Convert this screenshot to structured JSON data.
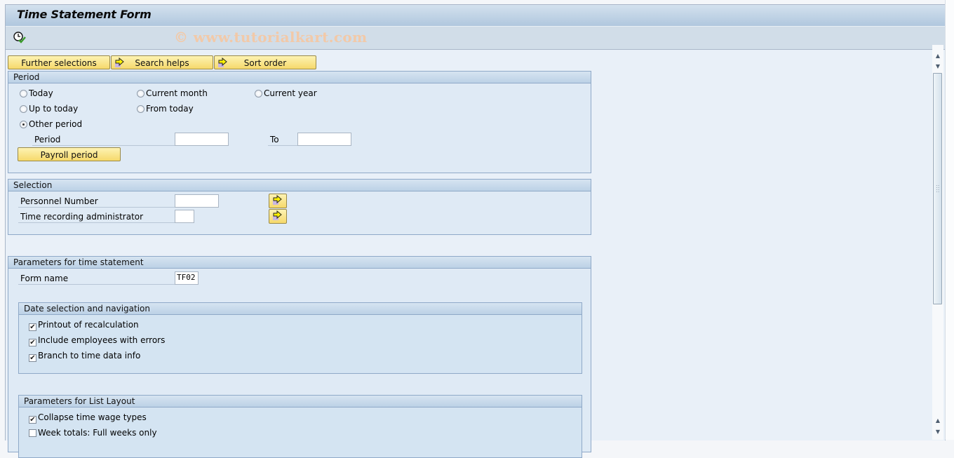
{
  "window": {
    "title": "Time Statement Form",
    "watermark": "© www.tutorialkart.com"
  },
  "toolbar": {
    "execute_icon": "clock-check-icon"
  },
  "tabs": [
    {
      "label": "Further selections",
      "icon": null
    },
    {
      "label": "Search helps",
      "icon": "arrow-right-icon"
    },
    {
      "label": "Sort order",
      "icon": "arrow-right-icon"
    }
  ],
  "period": {
    "title": "Period",
    "options": [
      {
        "label": "Today",
        "selected": false
      },
      {
        "label": "Current month",
        "selected": false
      },
      {
        "label": "Current year",
        "selected": false
      },
      {
        "label": "Up to today",
        "selected": false
      },
      {
        "label": "From today",
        "selected": false
      },
      {
        "label": "Other period",
        "selected": true
      }
    ],
    "period_label": "Period",
    "period_from": "",
    "to_label": "To",
    "period_to": "",
    "payroll_button": "Payroll period"
  },
  "selection": {
    "title": "Selection",
    "fields": [
      {
        "label": "Personnel Number",
        "value": ""
      },
      {
        "label": "Time recording administrator",
        "value": ""
      }
    ]
  },
  "parameters": {
    "title": "Parameters for time statement",
    "form_name_label": "Form name",
    "form_name_value": "TF02",
    "date_selection": {
      "title": "Date selection and navigation",
      "checks": [
        {
          "label": "Printout of recalculation",
          "checked": true
        },
        {
          "label": "Include employees with errors",
          "checked": true
        },
        {
          "label": "Branch to time data info",
          "checked": true
        }
      ]
    },
    "list_layout": {
      "title": "Parameters for List Layout",
      "checks": [
        {
          "label": "Collapse time wage types",
          "checked": true
        },
        {
          "label": "Week totals: Full weeks only",
          "checked": false
        }
      ]
    }
  },
  "colors": {
    "button_yellow": "#f6d96b",
    "group_border": "#8fa9c8",
    "title_bar": "#b0c7de"
  }
}
